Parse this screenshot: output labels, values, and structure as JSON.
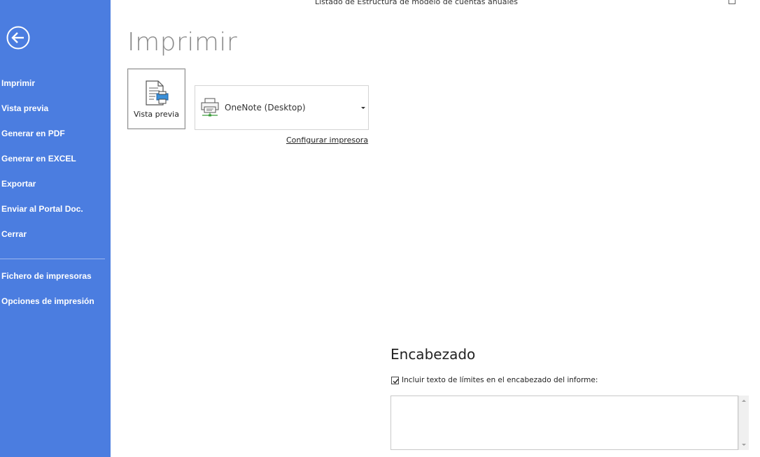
{
  "window": {
    "title": "Listado de Estructura de modelo de cuentas anuales"
  },
  "sidebar": {
    "back_icon": "arrow-left-circle-icon",
    "items": [
      {
        "label": "Imprimir"
      },
      {
        "label": "Vista previa"
      },
      {
        "label": "Generar en PDF"
      },
      {
        "label": "Generar en EXCEL"
      },
      {
        "label": "Exportar"
      },
      {
        "label": "Enviar al Portal Doc."
      },
      {
        "label": "Cerrar"
      }
    ],
    "secondary_items": [
      {
        "label": "Fichero de impresoras"
      },
      {
        "label": "Opciones de impresión"
      }
    ],
    "background_color": "#4b7de0"
  },
  "main": {
    "title": "Imprimir",
    "preview_button": {
      "label": "Vista previa",
      "icon": "print-preview-icon"
    },
    "printer": {
      "selected": "OneNote (Desktop)",
      "icon": "printer-icon"
    },
    "configure_link": "Configurar impresora"
  },
  "header_section": {
    "title": "Encabezado",
    "checkbox_label": "Incluir texto de límites en el encabezado del informe:",
    "checkbox_checked": true,
    "text_value": ""
  }
}
